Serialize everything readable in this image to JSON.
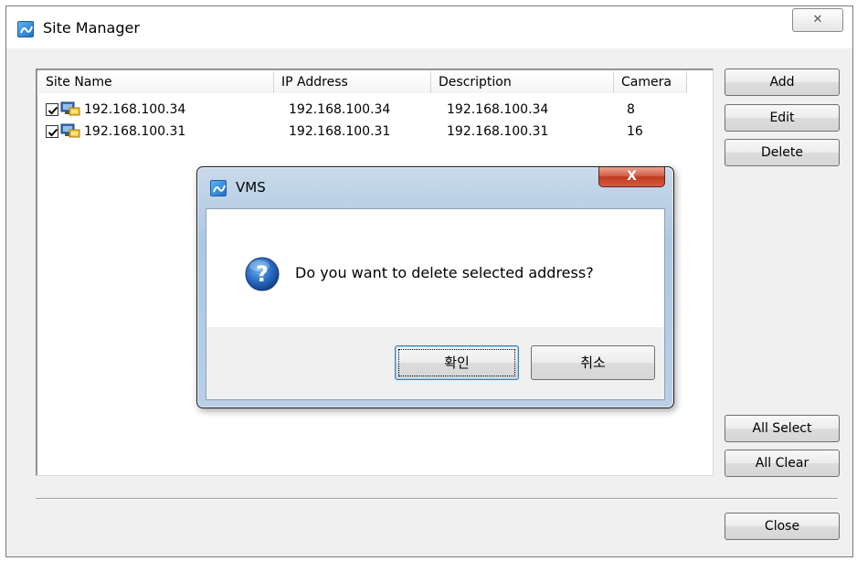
{
  "window": {
    "title": "Site Manager",
    "close_glyph": "✕"
  },
  "list": {
    "columns": [
      "Site Name",
      "IP Address",
      "Description",
      "Camera"
    ],
    "rows": [
      {
        "checked": true,
        "site_name": "192.168.100.34",
        "ip": "192.168.100.34",
        "description": "192.168.100.34",
        "camera": "8"
      },
      {
        "checked": true,
        "site_name": "192.168.100.31",
        "ip": "192.168.100.31",
        "description": "192.168.100.31",
        "camera": "16"
      }
    ]
  },
  "buttons": {
    "add": "Add",
    "edit": "Edit",
    "delete": "Delete",
    "all_select": "All Select",
    "all_clear": "All Clear",
    "close": "Close"
  },
  "dialog": {
    "title": "VMS",
    "close_glyph": "X",
    "message": "Do you want to delete selected address?",
    "icon": "question-icon",
    "ok_label": "확인",
    "cancel_label": "취소"
  },
  "colors": {
    "dialog_close_red": "#c03a22",
    "question_blue": "#1f5fb0"
  }
}
